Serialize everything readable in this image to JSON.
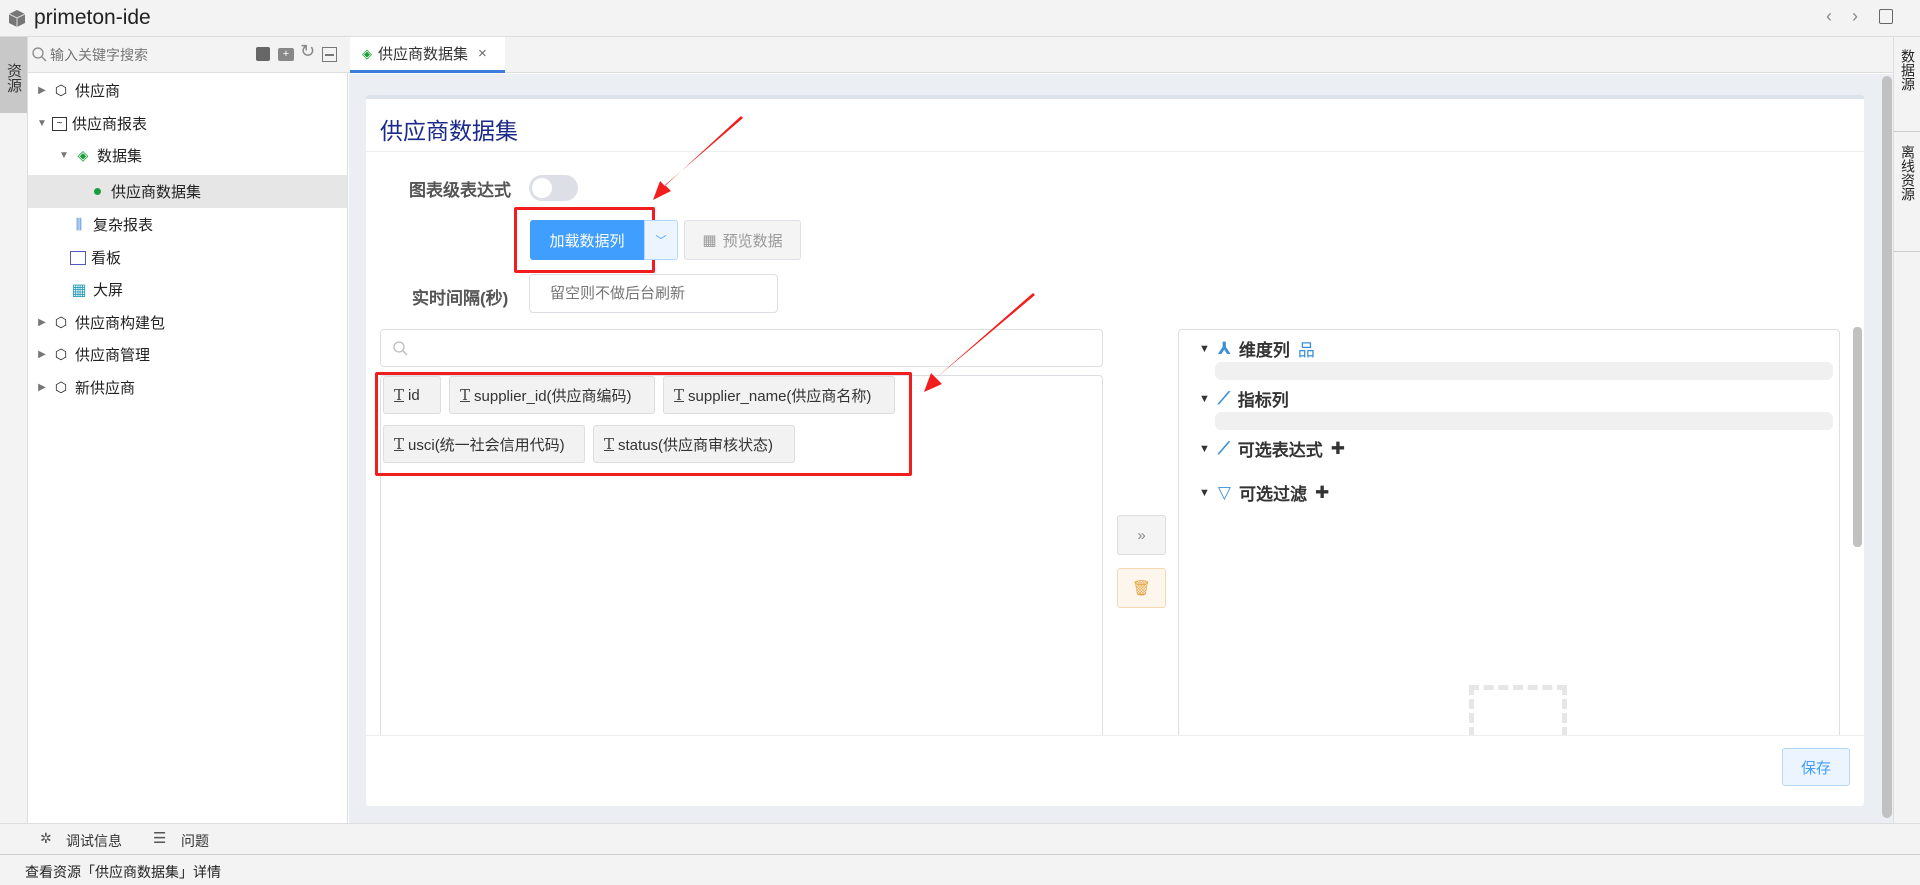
{
  "app": {
    "title": "primeton-ide"
  },
  "left_strip": {
    "resource_tab": "资源"
  },
  "tree": {
    "search_placeholder": "输入关键字搜索",
    "items": [
      {
        "label": "供应商"
      },
      {
        "label": "供应商报表"
      },
      {
        "label": "数据集"
      },
      {
        "label": "供应商数据集"
      },
      {
        "label": "复杂报表"
      },
      {
        "label": "看板"
      },
      {
        "label": "大屏"
      },
      {
        "label": "供应商构建包"
      },
      {
        "label": "供应商管理"
      },
      {
        "label": "新供应商"
      }
    ]
  },
  "editor_tab": {
    "label": "供应商数据集",
    "close": "×"
  },
  "right_strip": {
    "datasource": "数据源",
    "offline": "离线资源"
  },
  "card": {
    "title": "供应商数据集",
    "chart_expression_label": "图表级表达式",
    "chart_expression_on": false,
    "load_columns_button": "加载数据列",
    "preview_button": "预览数据",
    "interval_label": "实时间隔(秒)",
    "interval_placeholder": "留空则不做后台刷新",
    "columns": [
      {
        "label": "id"
      },
      {
        "label": "supplier_id(供应商编码)"
      },
      {
        "label": "supplier_name(供应商名称)"
      },
      {
        "label": "usci(统一社会信用代码)"
      },
      {
        "label": "status(供应商审核状态)"
      }
    ],
    "move_button": "»",
    "sections": [
      {
        "label": "维度列"
      },
      {
        "label": "指标列"
      },
      {
        "label": "可选表达式"
      },
      {
        "label": "可选过滤"
      }
    ],
    "save_button": "保存"
  },
  "bottom_tabs": {
    "debug": "调试信息",
    "problems": "问题"
  },
  "status_bar": {
    "text": "查看资源「供应商数据集」详情"
  },
  "colors": {
    "primary": "#409eff",
    "annotation": "#f21d1d",
    "title": "#1b2a8a"
  }
}
